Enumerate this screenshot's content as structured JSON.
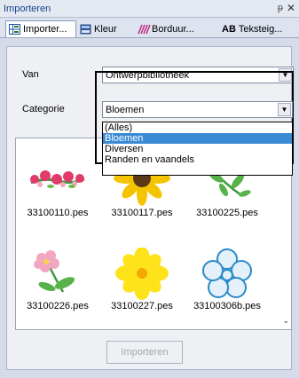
{
  "window": {
    "title": "Importeren",
    "pin_glyph": "ᵽ",
    "close_glyph": "✕"
  },
  "tabs": [
    {
      "label": "Importer...",
      "icon": "grid-icon",
      "active": true
    },
    {
      "label": "Kleur",
      "icon": "palette-icon",
      "active": false
    },
    {
      "label": "Borduur...",
      "icon": "stitch-icon",
      "active": false
    },
    {
      "label": "Teksteig...",
      "icon": "text-ab-icon",
      "icon_text": "AB",
      "active": false
    }
  ],
  "form": {
    "van_label": "Van",
    "van_value": "Ontwerpbibliotheek",
    "categorie_label": "Categorie",
    "categorie_value": "Bloemen",
    "categorie_options": [
      "(Alles)",
      "Bloemen",
      "Diversen",
      "Randen en vaandels"
    ],
    "categorie_selected_index": 1
  },
  "files": [
    {
      "name": "33100110.pes"
    },
    {
      "name": "33100117.pes"
    },
    {
      "name": "33100225.pes"
    },
    {
      "name": "33100226.pes"
    },
    {
      "name": "33100227.pes"
    },
    {
      "name": "33100306b.pes"
    }
  ],
  "import_button": {
    "label": "Importeren",
    "enabled": false
  },
  "colors": {
    "selection": "#3a8ad6",
    "title_text": "#15428b"
  }
}
